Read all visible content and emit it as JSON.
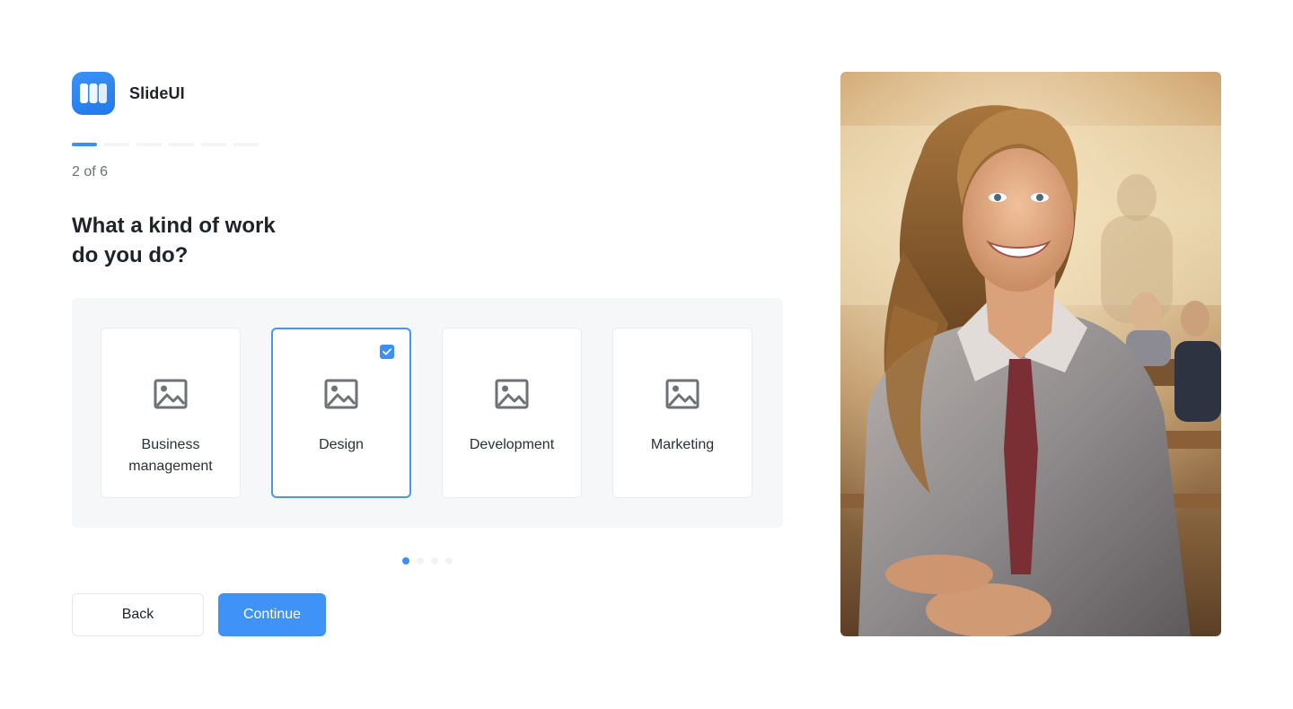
{
  "brand": {
    "name": "SlideUI",
    "logo_icon": "slides-logo-icon",
    "color": "#2b86f2"
  },
  "progress": {
    "current": 2,
    "total": 6,
    "text": "2 of 6"
  },
  "question": {
    "line1": "What a kind of work",
    "line2": "do you do?"
  },
  "options": [
    {
      "label": "Business management",
      "icon": "image-icon",
      "selected": false
    },
    {
      "label": "Design",
      "icon": "image-icon",
      "selected": true
    },
    {
      "label": "Development",
      "icon": "image-icon",
      "selected": false
    },
    {
      "label": "Marketing",
      "icon": "image-icon",
      "selected": false
    }
  ],
  "pagination": {
    "current": 1,
    "total": 4
  },
  "buttons": {
    "back": "Back",
    "continue": "Continue"
  },
  "colors": {
    "accent": "#3d8ef5",
    "panel": "#f6f7f8",
    "text": "#1f2328",
    "muted": "#6b7079"
  },
  "hero": {
    "icon": "portrait-photo"
  }
}
